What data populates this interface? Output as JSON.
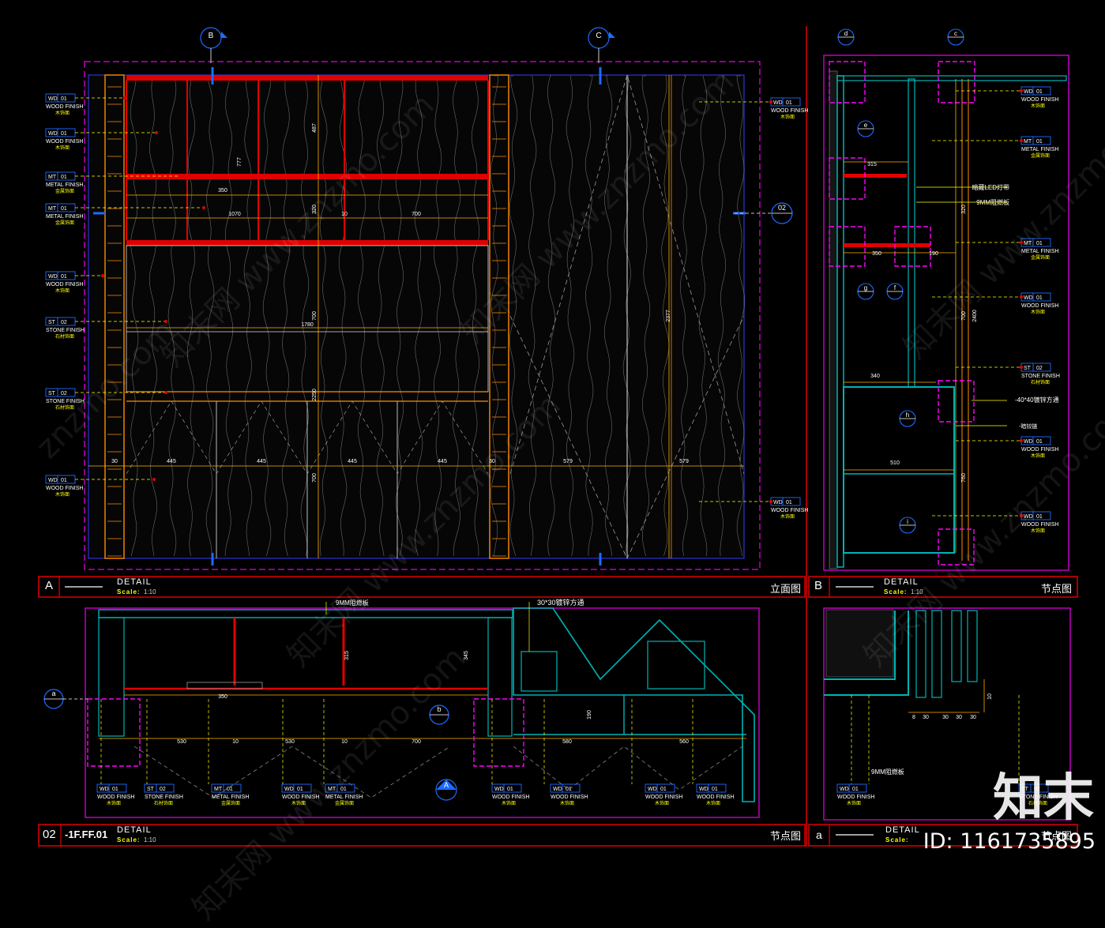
{
  "labels": {
    "wood": [
      "WD",
      "01",
      "WOOD FINISH",
      "木饰面"
    ],
    "metal": [
      "MT",
      "01",
      "METAL FINISH",
      "金属饰面"
    ],
    "stone": [
      "ST",
      "02",
      "STONE FINISH",
      "石材饰面"
    ]
  },
  "panelA": {
    "letter": "A",
    "title": "DETAIL",
    "scale": "Scale:",
    "scale_value": "1:10",
    "type": "立面图",
    "callout_b": "B",
    "callout_c": "C",
    "callout_02": "02",
    "dims": [
      "350",
      "1070",
      "10",
      "700",
      "1780",
      "445",
      "445",
      "445",
      "445",
      "579",
      "579",
      "2377",
      "777",
      "487",
      "320",
      "700",
      "2250",
      "700",
      "30",
      "30"
    ]
  },
  "panelB": {
    "letter": "B",
    "title": "DETAIL",
    "scale": "Scale:",
    "scale_value": "1:10",
    "type": "节点图",
    "callouts": [
      "d",
      "c",
      "e",
      "g",
      "f",
      "h",
      "i"
    ],
    "notes": [
      "暗藏LED灯带",
      "9MM阻燃板",
      "-40*40镀锌方通",
      "-暗铰链"
    ],
    "dims": [
      "315",
      "350",
      "190",
      "340",
      "510",
      "700",
      "2400",
      "320",
      "760"
    ]
  },
  "panel02": {
    "letter": "02",
    "ref": "-1F.FF.01",
    "title": "DETAIL",
    "scale": "Scale:",
    "scale_value": "1:10",
    "type": "节点图",
    "notes": [
      "9MM阻燃板",
      "30*30镀锌方通"
    ],
    "callout_a": "a",
    "callout_b": "b",
    "callout_A": "A",
    "dims": [
      "350",
      "530",
      "10",
      "530",
      "10",
      "700",
      "580",
      "560",
      "315",
      "345",
      "190"
    ]
  },
  "panela": {
    "letter": "a",
    "title": "DETAIL",
    "scale": "Scale:",
    "type": "节点图",
    "notes": [
      "9MM阻燃板"
    ],
    "dims": [
      "30",
      "30",
      "30",
      "30",
      "10",
      "8"
    ]
  },
  "watermarks": [
    "知末网 www.znzmo.com",
    "znzmo.com"
  ],
  "brand": "知末",
  "id": "ID: 1161735895",
  "colors": {
    "background": "#000000",
    "frame_red": "#e60000",
    "frame_magenta": "#ff00ff",
    "callout_blue": "#1e6bff",
    "leader_yellow": "#ffff00",
    "wood_orange": "#ff8c00",
    "detail_cyan": "#00b3b3"
  }
}
